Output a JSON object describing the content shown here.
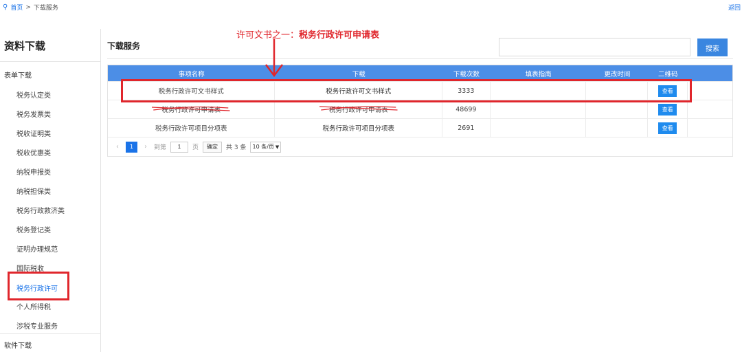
{
  "breadcrumb": {
    "home": "首页",
    "separator": ">",
    "current": "下载服务",
    "back": "返回"
  },
  "sidebar": {
    "title": "资料下载",
    "group": "表单下载",
    "items": [
      {
        "label": "税务认定类"
      },
      {
        "label": "税务发票类"
      },
      {
        "label": "税收证明类"
      },
      {
        "label": "税收优惠类"
      },
      {
        "label": "纳税申报类"
      },
      {
        "label": "纳税担保类"
      },
      {
        "label": "税务行政救济类"
      },
      {
        "label": "税务登记类"
      },
      {
        "label": "证明办理规范"
      },
      {
        "label": "国际税收"
      },
      {
        "label": "税务行政许可",
        "active": true
      },
      {
        "label": "个人所得税"
      },
      {
        "label": "涉税专业服务"
      }
    ],
    "group2": "软件下载"
  },
  "main": {
    "title": "下载服务",
    "search_placeholder": "",
    "search_button": "搜索"
  },
  "table": {
    "headers": [
      "事项名称",
      "下载",
      "下载次数",
      "填表指南",
      "更改时间",
      "二维码"
    ],
    "rows": [
      {
        "name": "税务行政许可文书样式",
        "download": "税务行政许可文书样式",
        "count": "3333",
        "guide": "",
        "time": "",
        "qr": "查看"
      },
      {
        "name": "税务行政许可申请表",
        "download": "税务行政许可申请表",
        "count": "48699",
        "guide": "",
        "time": "",
        "qr": "查看"
      },
      {
        "name": "税务行政许可项目分项表",
        "download": "税务行政许可项目分项表",
        "count": "2691",
        "guide": "",
        "time": "",
        "qr": "查看"
      }
    ]
  },
  "pagination": {
    "prev": "‹",
    "page": "1",
    "next": "›",
    "goto_label": "到第",
    "goto_value": "1",
    "page_label": "页",
    "confirm": "确定",
    "total": "共 3 条",
    "per_page": "10 条/页"
  },
  "annotation": {
    "prefix": "许可文书之一：",
    "bold": "税务行政许可申请表"
  },
  "colors": {
    "accent": "#4c8ee6",
    "highlight": "#e0262c",
    "button": "#1f8bee"
  }
}
